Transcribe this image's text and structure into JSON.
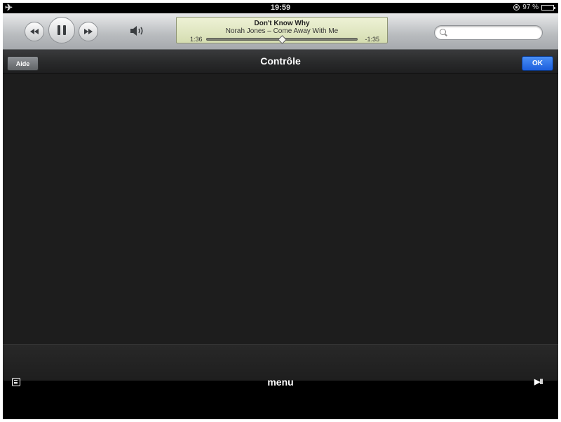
{
  "status_bar": {
    "time": "19:59",
    "battery_percent": "97 %",
    "battery_level": 0.97
  },
  "now_playing": {
    "title": "Don't Know Why",
    "artist_album": "Norah Jones – Come Away With Me",
    "elapsed": "1:36",
    "remaining": "-1:35",
    "progress": 0.5
  },
  "search": {
    "value": "",
    "placeholder": ""
  },
  "nav": {
    "title": "Contrôle",
    "help_label": "Aide",
    "ok_label": "OK"
  },
  "bottom": {
    "menu_label": "menu"
  },
  "colors": {
    "ok_blue": "#1d5fdd",
    "panel_dark": "#1d1d1d",
    "lcd_green": "#e3e9c4"
  }
}
